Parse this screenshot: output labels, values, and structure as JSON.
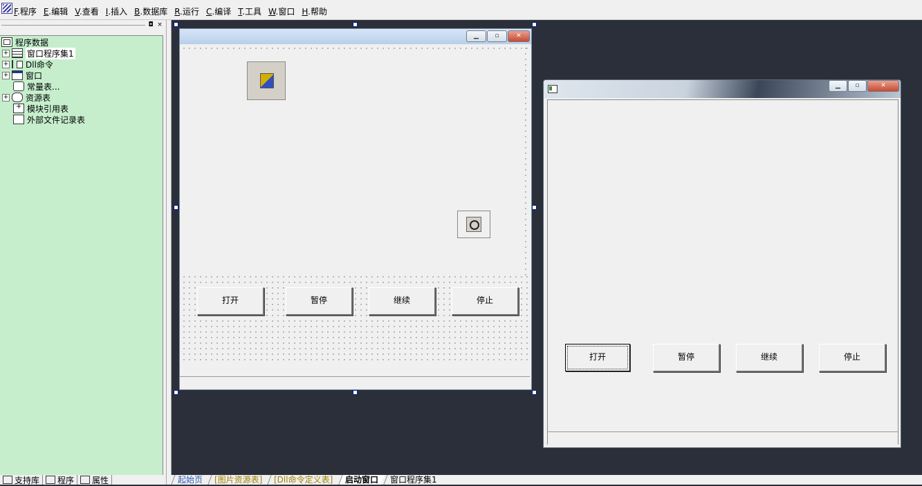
{
  "menu": [
    {
      "key": "F",
      "label": "程序"
    },
    {
      "key": "E",
      "label": "编辑"
    },
    {
      "key": "V",
      "label": "查看"
    },
    {
      "key": "I",
      "label": "插入"
    },
    {
      "key": "B",
      "label": "数据库"
    },
    {
      "key": "R",
      "label": "运行"
    },
    {
      "key": "C",
      "label": "编译"
    },
    {
      "key": "T",
      "label": "工具"
    },
    {
      "key": "W",
      "label": "窗口"
    },
    {
      "key": "H",
      "label": "帮助"
    }
  ],
  "tree": {
    "root": "程序数据",
    "items": [
      {
        "label": "窗口程序集1",
        "icon": "stack-icon",
        "expander": "+"
      },
      {
        "label": "Dll命令",
        "icon": "dll-icon",
        "expander": "+"
      },
      {
        "label": "窗口",
        "icon": "window-icon",
        "expander": "+"
      },
      {
        "label": "常量表...",
        "icon": "constant-icon",
        "expander": ""
      },
      {
        "label": "资源表",
        "icon": "resource-icon",
        "expander": "+"
      },
      {
        "label": "模块引用表",
        "icon": "module-icon",
        "expander": ""
      },
      {
        "label": "外部文件记录表",
        "icon": "file-icon",
        "expander": ""
      }
    ]
  },
  "left_tabs": [
    "支持库",
    "程序",
    "属性"
  ],
  "doc_tabs": [
    "起始页",
    "[图片资源表]",
    "[Dll命令定义表]",
    "启动窗口",
    "窗口程序集1"
  ],
  "designer": {
    "buttons": [
      "打开",
      "暂停",
      "继续",
      "停止"
    ],
    "window_buttons": {
      "minimize": "▁",
      "maximize": "▫",
      "close": "✕"
    }
  },
  "running_window": {
    "buttons": [
      "打开",
      "暂停",
      "继续",
      "停止"
    ],
    "window_buttons": {
      "minimize": "▁",
      "maximize": "▫",
      "close": "✕"
    }
  },
  "left_panel_buttons": {
    "pin": "◘",
    "close": "×"
  }
}
